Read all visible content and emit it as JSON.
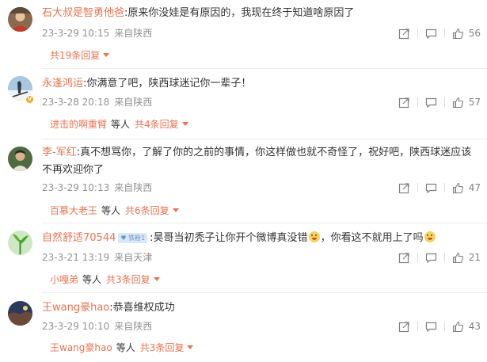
{
  "comments": [
    {
      "user": "石大叔是智勇他爸",
      "text": ":原来你没娃是有原因的，我现在终于知道啥原因了",
      "date": "23-3-29 10:15",
      "location": "来自陕西",
      "likes": "56",
      "reply_user": "",
      "reply_mid": "",
      "reply_count": "共19条回复"
    },
    {
      "user": "永逢鸿运",
      "text": ":你满意了吧，陕西球迷记你一辈子！",
      "date": "23-3-28 20:18",
      "location": "来自陕西",
      "likes": "57",
      "reply_user": "进击的啊重臂",
      "reply_mid": "等人",
      "reply_count": "共4条回复"
    },
    {
      "user": "李-军红",
      "text": ":真不想骂你，了解了你的之前的事情，你这样做也就不奇怪了，祝好吧，陕西球迷应该",
      "text2": "不再欢迎你了",
      "date": "23-3-29 10:13",
      "location": "来自陕西",
      "likes": "47",
      "reply_user": "百慕大老王",
      "reply_mid": "等人",
      "reply_count": "共6条回复"
    },
    {
      "user": "自然舒适70544",
      "badge": "铁粉1",
      "text": ":昊哥当初秃子让你开个微博真没错",
      "text_b": "，你看这不就用上了吗",
      "date": "23-3-21 13:19",
      "location": "来自天津",
      "likes": "21",
      "reply_user": "小嘎弟",
      "reply_mid": "等人",
      "reply_count": "共3条回复"
    },
    {
      "user": "王wang豪hao",
      "text": ":恭喜维权成功",
      "date": "23-3-29 10:10",
      "location": "来自陕西",
      "likes": "43",
      "reply_user": "王wang豪hao",
      "reply_mid": "等人",
      "reply_count": "共3条回复"
    }
  ],
  "icons": {
    "share": "share-icon",
    "comment": "comment-icon",
    "like": "thumbs-up-icon",
    "avatar_badge": "verified-v-badge",
    "emoji": "smile-emoji"
  },
  "colors": {
    "username": "#eb7350",
    "text": "#333333",
    "meta": "#939393"
  }
}
